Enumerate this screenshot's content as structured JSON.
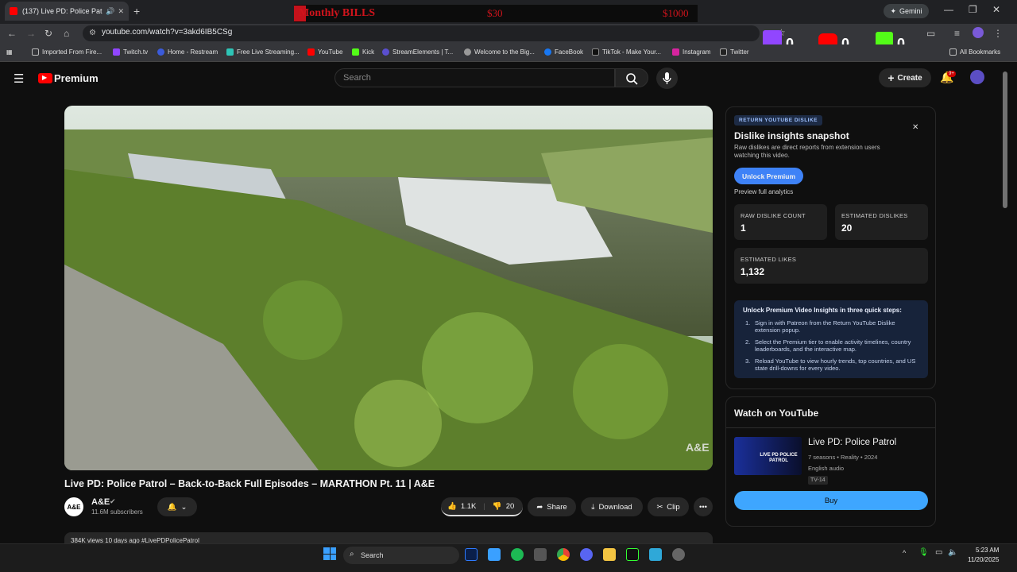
{
  "browser": {
    "tab_title": "(137) Live PD: Police Patrol",
    "new_tab": "+",
    "url": "youtube.com/watch?v=3akd6IB5CSg",
    "gemini_label": "Gemini",
    "ext_counts": [
      "0",
      "0",
      "0"
    ],
    "bookmarks": [
      "Imported From Fire...",
      "Twitch.tv",
      "Home - Restream",
      "Free Live Streaming...",
      "YouTube",
      "Kick",
      "StreamElements | T...",
      "Welcome to the Big...",
      "FaceBook",
      "TikTok - Make Your...",
      "Instagram",
      "Twitter"
    ],
    "all_bookmarks": "All Bookmarks"
  },
  "overlay": {
    "title": "Monthly BILLS",
    "amount_current": "$30",
    "amount_goal": "$1000"
  },
  "header": {
    "logo": "Premium",
    "search_placeholder": "Search",
    "create_label": "Create",
    "notif_badge": "9+"
  },
  "video": {
    "title": "Live PD: Police Patrol – Back-to-Back Full Episodes – MARATHON Pt. 11 | A&E",
    "watermark": "A&E",
    "channel_logo": "A&E",
    "channel_name": "A&E",
    "subscribers": "11.6M subscribers",
    "likes": "1.1K",
    "dislikes": "20",
    "share": "Share",
    "download": "Download",
    "clip": "Clip",
    "description_preview": "384K views  10 days ago  #LivePDPolicePatrol"
  },
  "ryd": {
    "badge": "RETURN YOUTUBE DISLIKE",
    "heading": "Dislike insights snapshot",
    "desc": "Raw dislikes are direct reports from extension users watching this video.",
    "unlock_btn": "Unlock Premium",
    "preview": "Preview full analytics",
    "raw_label": "RAW DISLIKE COUNT",
    "raw_value": "1",
    "est_dis_label": "ESTIMATED DISLIKES",
    "est_dis_value": "20",
    "est_like_label": "ESTIMATED LIKES",
    "est_like_value": "1,132",
    "steps_title": "Unlock Premium Video Insights in three quick steps:",
    "step1": "Sign in with Patreon from the Return YouTube Dislike extension popup.",
    "step2": "Select the Premium tier to enable activity timelines, country leaderboards, and the interactive map.",
    "step3": "Reload YouTube to view hourly trends, top countries, and US state drill-downs for every video."
  },
  "watch": {
    "heading": "Watch on YouTube",
    "show_title": "Live PD: Police Patrol",
    "thumb_text": "LIVE PD POLICE PATROL",
    "meta": "7 seasons • Reality • 2024",
    "audio": "English audio",
    "rating": "TV-14",
    "buy": "Buy"
  },
  "taskbar": {
    "search": "Search",
    "time": "5:23 AM",
    "date": "11/20/2025"
  }
}
